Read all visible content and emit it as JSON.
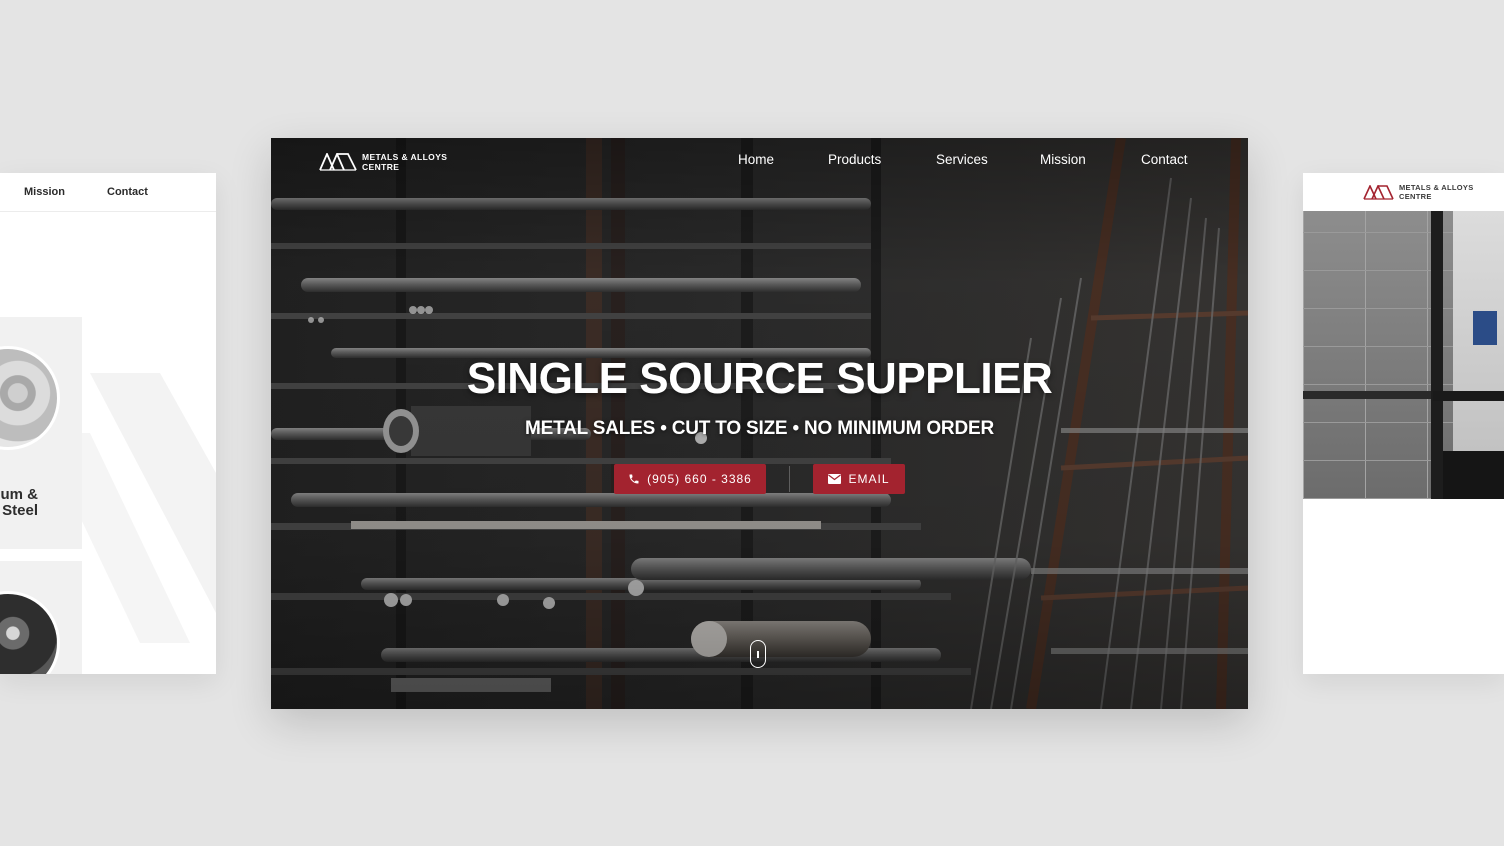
{
  "left_card": {
    "nav": [
      "Mission",
      "Contact"
    ],
    "tile_label_line1": "um &",
    "tile_label_line2": "Steel"
  },
  "right_card": {
    "logo_line1": "METALS & ALLOYS",
    "logo_line2": "CENTRE"
  },
  "hero": {
    "logo_line1": "METALS & ALLOYS",
    "logo_line2": "CENTRE",
    "nav": [
      "Home",
      "Products",
      "Services",
      "Mission",
      "Contact"
    ],
    "headline": "SINGLE SOURCE SUPPLIER",
    "subheadline": "METAL SALES • CUT TO SIZE • NO MINIMUM ORDER",
    "phone_button": "(905) 660 - 3386",
    "email_button": "EMAIL"
  },
  "colors": {
    "brand_red": "#a3232f",
    "page_background": "#e4e4e4"
  },
  "icons": [
    "logo-mark-icon",
    "phone-icon",
    "envelope-icon",
    "scroll-mouse-icon"
  ]
}
